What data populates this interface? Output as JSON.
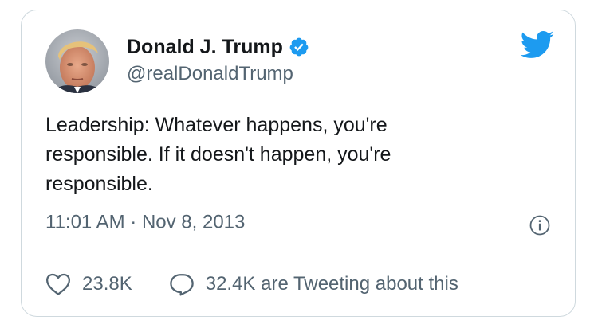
{
  "user": {
    "display_name": "Donald J. Trump",
    "handle": "@realDonaldTrump",
    "verified": true
  },
  "tweet": {
    "text": "Leadership: Whatever happens, you're\nresponsible. If it doesn't happen, you're\nresponsible.",
    "time": "11:01 AM",
    "separator": " · ",
    "date": "Nov 8, 2013"
  },
  "actions": {
    "like_count": "23.8K",
    "reply_text": "32.4K are Tweeting about this"
  },
  "icons": {
    "brand": "twitter-bird-icon",
    "verified": "verified-badge-icon",
    "info": "info-icon",
    "like": "heart-icon",
    "reply": "speech-bubble-icon"
  },
  "colors": {
    "brand_blue": "#1d9bf0",
    "text_primary": "#14171a",
    "text_secondary": "#536471",
    "border": "#cfd9de"
  }
}
